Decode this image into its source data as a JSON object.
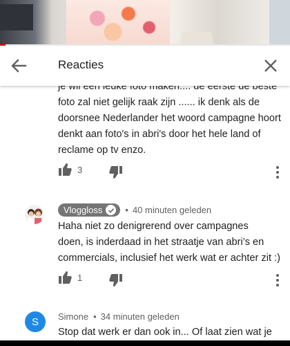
{
  "video": {
    "progress_percent": 2,
    "accent": "#ff0000"
  },
  "header": {
    "title": "Reacties",
    "back_icon": "arrow-left-icon",
    "close_icon": "close-icon"
  },
  "comments": [
    {
      "text_lines": [
        "je wil een leuke foto maken.... de eerste de beste",
        "foto zal niet gelijk raak zijn ...... ik denk als de",
        "doorsnee Nederlander het woord campagne hoort",
        "denkt aan foto's in abri's door het hele land of",
        "reclame op tv enzo."
      ],
      "likes": "3"
    },
    {
      "author": "Vloggloss",
      "author_badge": "verified-creator",
      "time": "40 minuten geleden",
      "text_lines": [
        "Haha niet zo denigrerend over campagnes",
        "doen, is inderdaad in het straatje van abri’s en",
        "commercials, inclusief het werk wat er achter zit :)"
      ],
      "likes": "1"
    },
    {
      "avatar_letter": "S",
      "author": "Simone",
      "time": "34 minuten geleden",
      "text_lines": [
        "Stop dat werk er dan ook in... Of laat zien wat je"
      ]
    }
  ],
  "separator": "•",
  "colors": {
    "avatar_s": "#1e88e5",
    "badge": "#757575"
  }
}
